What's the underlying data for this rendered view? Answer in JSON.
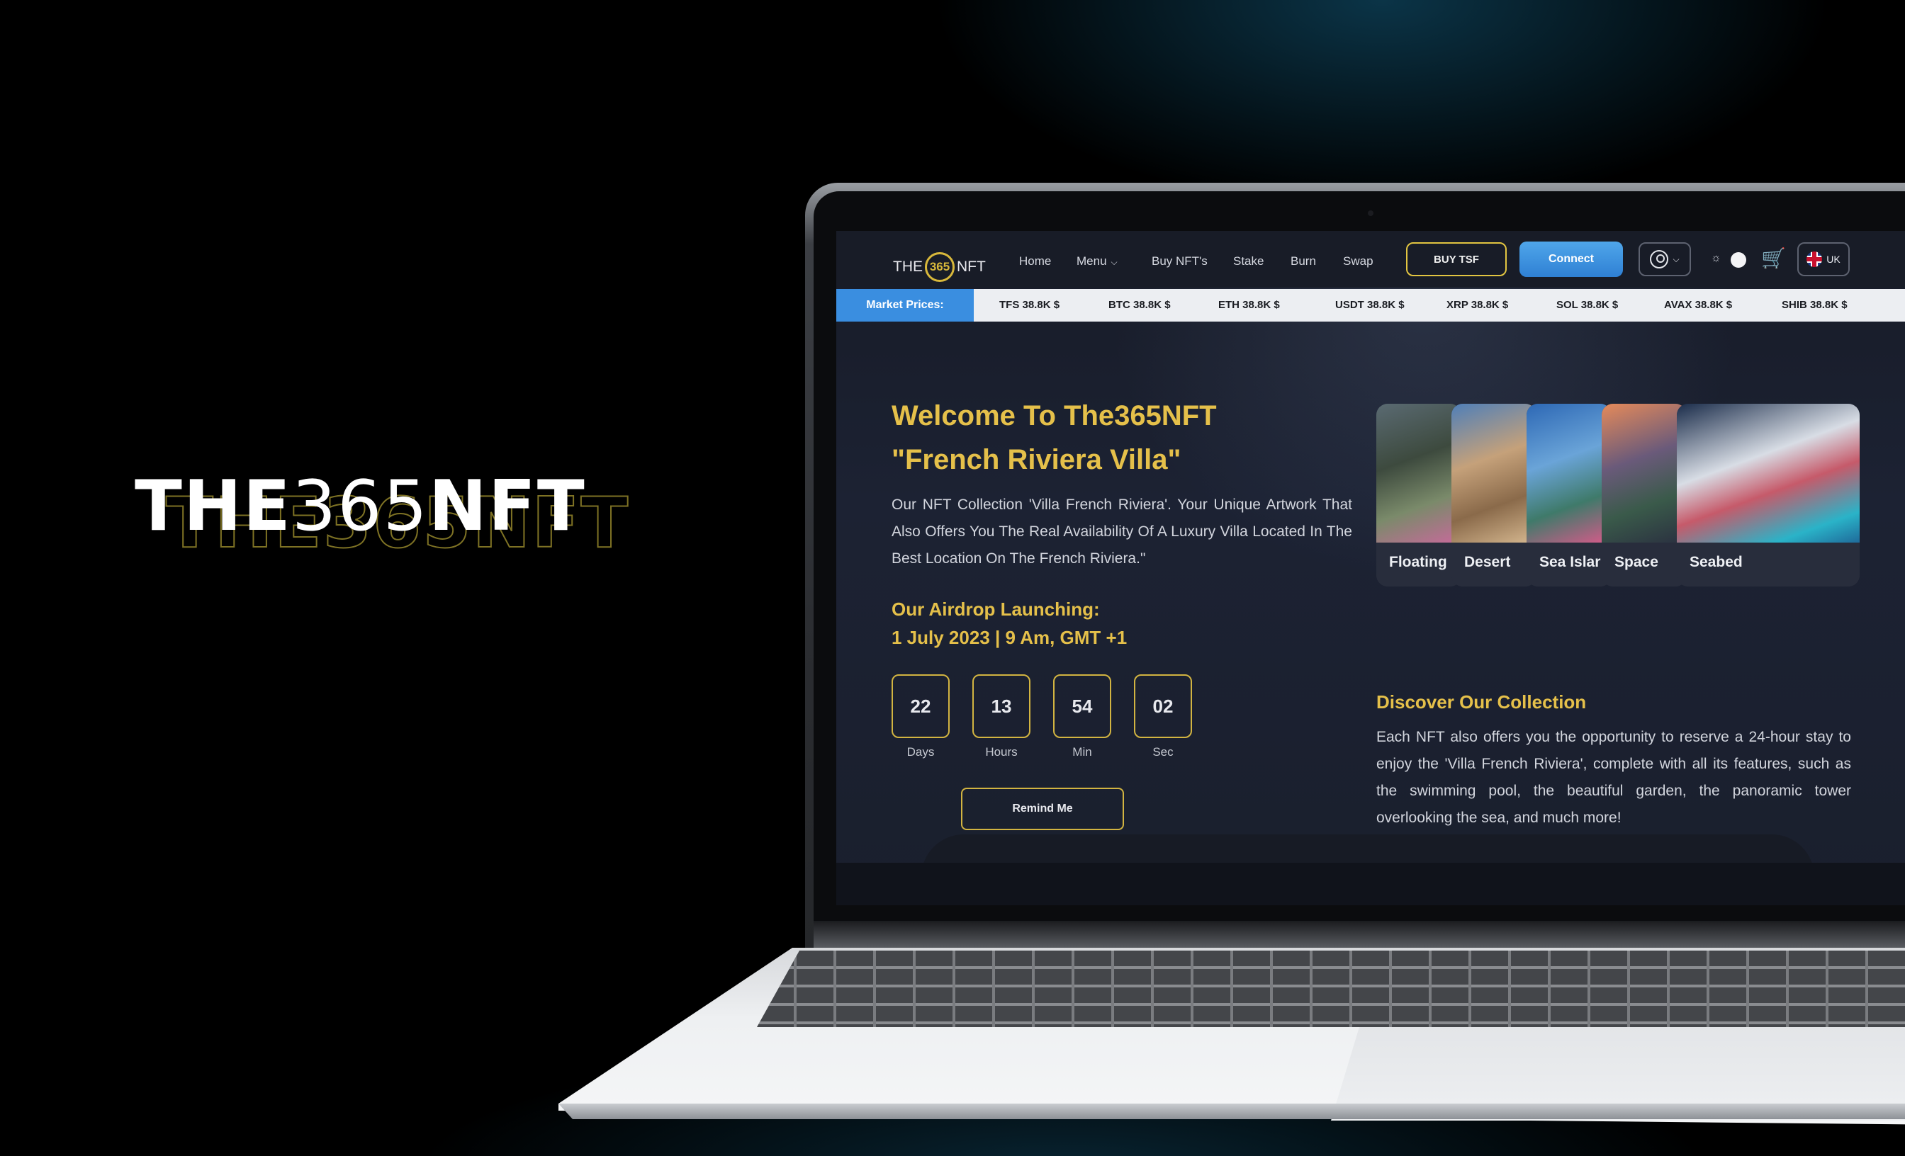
{
  "brand": {
    "prefix": "THE",
    "number": "365",
    "suffix": "NFT"
  },
  "nav": {
    "logo": {
      "left": "THE",
      "mark": "365",
      "right": "NFT"
    },
    "links": [
      "Home",
      "Menu",
      "Buy NFT's",
      "Stake",
      "Burn",
      "Swap"
    ],
    "buy_label": "BUY TSF",
    "connect_label": "Connect",
    "language": "UK"
  },
  "ticker": {
    "label": "Market Prices:",
    "items": [
      "TFS 38.8K $",
      "BTC 38.8K $",
      "ETH 38.8K $",
      "USDT 38.8K $",
      "XRP 38.8K $",
      "SOL 38.8K $",
      "AVAX 38.8K $",
      "SHIB 38.8K $"
    ]
  },
  "hero": {
    "title_line1": "Welcome To The365NFT",
    "title_line2": "\"French Riviera Villa\"",
    "description": "Our NFT Collection 'Villa French Riviera'. Your Unique Artwork That Also Offers You The Real Availability Of A Luxury Villa Located In The Best Location On The French Riviera.\"",
    "airdrop_line1": "Our Airdrop Launching:",
    "airdrop_line2": "1 July 2023 | 9 Am, GMT +1"
  },
  "countdown": {
    "values": [
      "22",
      "13",
      "54",
      "02"
    ],
    "labels": [
      "Days",
      "Hours",
      "Min",
      "Sec"
    ],
    "remind_label": "Remind Me"
  },
  "collections": [
    "Floating",
    "Desert",
    "Sea Islar",
    "Space",
    "Seabed"
  ],
  "discover": {
    "title": "Discover Our Collection",
    "text": "Each NFT also offers you the opportunity to reserve a 24-hour stay to enjoy the 'Villa French Riviera', complete with all its features, such as the swimming pool, the beautiful garden, the panoramic tower overlooking the sea, and much more!"
  },
  "colors": {
    "gold": "#e5c04a",
    "blue": "#3a8ee0",
    "background": "#1a1f2d"
  },
  "icons": [
    "user-icon",
    "chevron-down-icon",
    "sun-icon",
    "cart-icon",
    "uk-flag-icon"
  ]
}
